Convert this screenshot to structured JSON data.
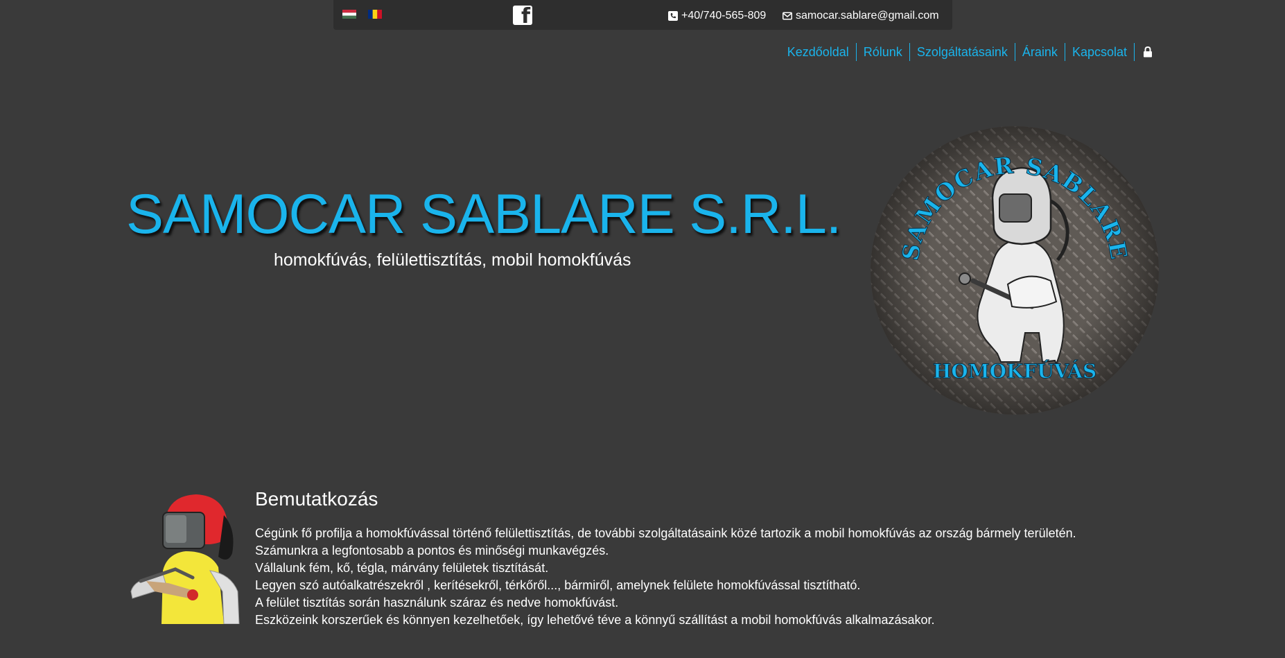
{
  "topbar": {
    "flags": [
      "hungarian-flag",
      "romanian-flag"
    ],
    "facebook_icon": "facebook-icon",
    "phone": "+40/740-565-809",
    "email": "samocar.sablare@gmail.com"
  },
  "nav": {
    "items": [
      "Kezdőoldal",
      "Rólunk",
      "Szolgáltatásaink",
      "Áraink",
      "Kapcsolat"
    ],
    "login_icon": "lock-icon"
  },
  "hero": {
    "title": "SAMOCAR SABLARE S.R.L.",
    "subtitle": "homokfúvás, felülettisztítás, mobil homokfúvás",
    "logo": {
      "top_text": "SAMOCAR SABLARE",
      "bottom_text": "HOMOKFÚVÁS"
    }
  },
  "intro": {
    "title": "Bemutatkozás",
    "lines": [
      "Cégünk fő profilja a homokfúvással történő felülettisztítás, de további szolgáltatásaink közé tartozik a mobil homokfúvás az ország bármely területén.",
      "Számunkra a legfontosabb a pontos és minőségi munkavégzés.",
      "Vállalunk fém, kő, tégla, márvány felületek tisztítását.",
      "Legyen szó autóalkatrészekről , kerítésekről, térkőről..., bármiről, amelynek felülete homokfúvással tisztítható.",
      "A felület tisztítás során használunk száraz és nedve homokfúvást.",
      "Eszközeink korszerűek és könnyen kezelhetőek, így lehetővé téve a könnyű szállítást a mobil homokfúvás alkalmazásakor."
    ]
  },
  "colors": {
    "background": "#3a3a3a",
    "topbar": "#2e2e2e",
    "accent": "#1ab4ec",
    "text": "#ffffff"
  }
}
